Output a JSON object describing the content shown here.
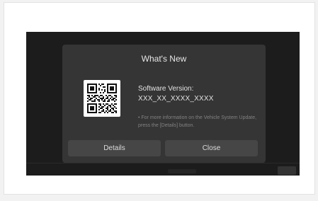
{
  "dialog": {
    "title": "What's New",
    "version_label": "Software Version:",
    "version_value": "XXX_XX_XXXX_XXXX",
    "info": "• For more information on the Vehicle System Update, press the [Details] button.",
    "buttons": {
      "details": "Details",
      "close": "Close"
    }
  },
  "colors": {
    "screen_background": "#1c1c1c",
    "dialog_background": "#353535",
    "button_background": "#464646"
  }
}
